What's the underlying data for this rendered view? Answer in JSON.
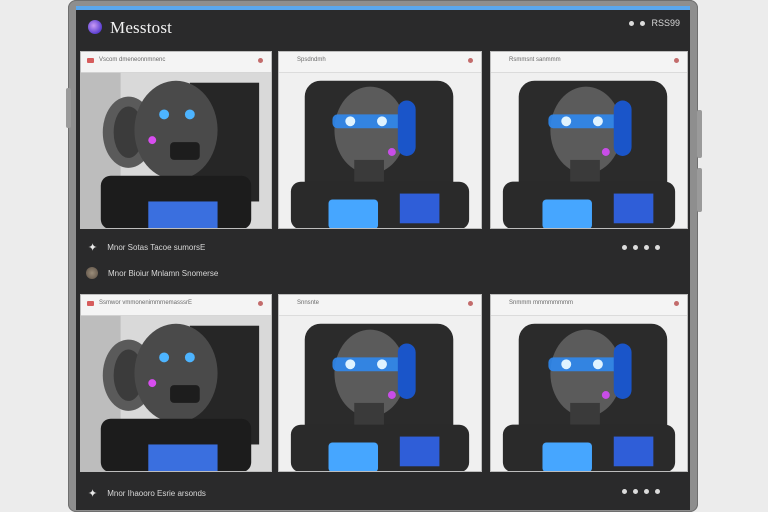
{
  "app": {
    "title": "Messtost",
    "top_status": "RSS99"
  },
  "rows": [
    {
      "cards": [
        {
          "caption": "Vscom dmeneonnmnenc",
          "style": "dark-side"
        },
        {
          "caption": "Spsdndmh",
          "style": "front"
        },
        {
          "caption": "Rsmmsnt sanmmm",
          "style": "front"
        }
      ],
      "prompt": "Mnor Sotas Tacoe sumorsE",
      "reply": "Mnor Bioiur Mnlamn Snomerse"
    },
    {
      "cards": [
        {
          "caption": "Ssmwor vmmonenimmrnemasssrE",
          "style": "dark-side"
        },
        {
          "caption": "Snnsnte",
          "style": "front"
        },
        {
          "caption": "Snmmm mmmmmmmm",
          "style": "front"
        }
      ],
      "prompt": "Mnor Ihaooro Esrie arsonds",
      "reply": ""
    }
  ]
}
